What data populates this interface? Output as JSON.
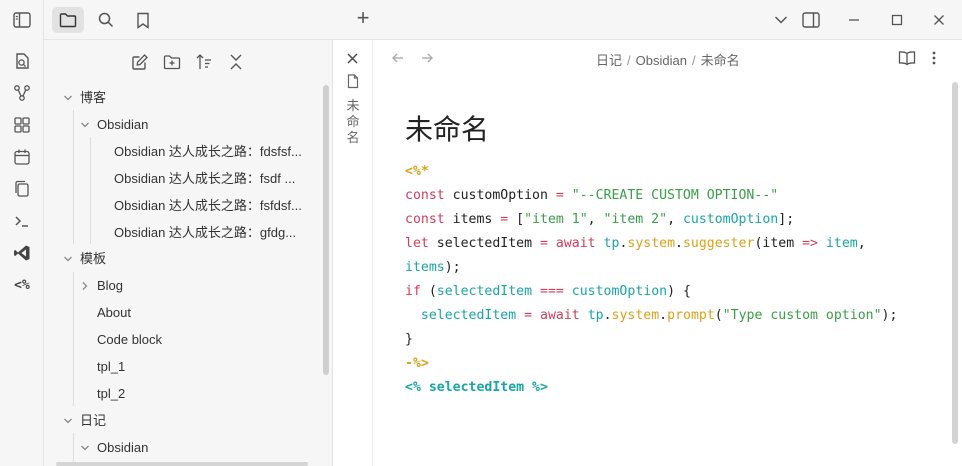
{
  "topbar": {
    "new_tab_symbol": "+"
  },
  "ribbon": {
    "templater_label": "<%"
  },
  "sidebar": {
    "tree": [
      {
        "label": "博客",
        "depth": 0,
        "expanded": true
      },
      {
        "label": "Obsidian",
        "depth": 1,
        "expanded": true
      },
      {
        "label": "Obsidian 达人成长之路：fdsfsf...",
        "depth": 2
      },
      {
        "label": "Obsidian 达人成长之路：fsdf ...",
        "depth": 2
      },
      {
        "label": "Obsidian 达人成长之路：fsfdsf...",
        "depth": 2
      },
      {
        "label": "Obsidian 达人成长之路：gfdg...",
        "depth": 2
      },
      {
        "label": "模板",
        "depth": 0,
        "expanded": true
      },
      {
        "label": "Blog",
        "depth": 1,
        "expanded": false
      },
      {
        "label": "About",
        "depth": 1
      },
      {
        "label": "Code block",
        "depth": 1
      },
      {
        "label": "tpl_1",
        "depth": 1
      },
      {
        "label": "tpl_2",
        "depth": 1
      },
      {
        "label": "日记",
        "depth": 0,
        "expanded": true
      },
      {
        "label": "Obsidian",
        "depth": 1,
        "expanded": true
      }
    ]
  },
  "stacked_tab": {
    "title": "未命名"
  },
  "breadcrumb": {
    "part1": "日记",
    "separator": "/",
    "part2": "Obsidian",
    "part3": "未命名"
  },
  "editor": {
    "title": "未命名",
    "code_lines": [
      [
        {
          "t": "<%*",
          "c": "tag"
        }
      ],
      [
        {
          "t": "const",
          "c": "kw"
        },
        {
          "t": " customOption ",
          "c": "pl"
        },
        {
          "t": "=",
          "c": "kw"
        },
        {
          "t": " ",
          "c": "pl"
        },
        {
          "t": "\"--CREATE CUSTOM OPTION--\"",
          "c": "str"
        }
      ],
      [
        {
          "t": "const",
          "c": "kw"
        },
        {
          "t": " items ",
          "c": "pl"
        },
        {
          "t": "=",
          "c": "kw"
        },
        {
          "t": " [",
          "c": "pl"
        },
        {
          "t": "\"item 1\"",
          "c": "str"
        },
        {
          "t": ", ",
          "c": "pl"
        },
        {
          "t": "\"item 2\"",
          "c": "str"
        },
        {
          "t": ", ",
          "c": "pl"
        },
        {
          "t": "customOption",
          "c": "var"
        },
        {
          "t": "];",
          "c": "pl"
        }
      ],
      [
        {
          "t": "let",
          "c": "kw"
        },
        {
          "t": " selectedItem ",
          "c": "pl"
        },
        {
          "t": "=",
          "c": "kw"
        },
        {
          "t": " ",
          "c": "pl"
        },
        {
          "t": "await",
          "c": "kw"
        },
        {
          "t": " ",
          "c": "pl"
        },
        {
          "t": "tp",
          "c": "var"
        },
        {
          "t": ".",
          "c": "pl"
        },
        {
          "t": "system",
          "c": "fn"
        },
        {
          "t": ".",
          "c": "pl"
        },
        {
          "t": "suggester",
          "c": "fn"
        },
        {
          "t": "(item ",
          "c": "pl"
        },
        {
          "t": "=>",
          "c": "kw"
        },
        {
          "t": " ",
          "c": "pl"
        },
        {
          "t": "item",
          "c": "var"
        },
        {
          "t": ",",
          "c": "pl"
        }
      ],
      [
        {
          "t": "items",
          "c": "var"
        },
        {
          "t": ");",
          "c": "pl"
        }
      ],
      [
        {
          "t": "if",
          "c": "kw"
        },
        {
          "t": " (",
          "c": "pl"
        },
        {
          "t": "selectedItem",
          "c": "var"
        },
        {
          "t": " ",
          "c": "pl"
        },
        {
          "t": "===",
          "c": "kw"
        },
        {
          "t": " ",
          "c": "pl"
        },
        {
          "t": "customOption",
          "c": "var"
        },
        {
          "t": ") {",
          "c": "pl"
        }
      ],
      [
        {
          "t": "  ",
          "c": "pl"
        },
        {
          "t": "selectedItem",
          "c": "var"
        },
        {
          "t": " ",
          "c": "pl"
        },
        {
          "t": "=",
          "c": "kw"
        },
        {
          "t": " ",
          "c": "pl"
        },
        {
          "t": "await",
          "c": "kw"
        },
        {
          "t": " ",
          "c": "pl"
        },
        {
          "t": "tp",
          "c": "var"
        },
        {
          "t": ".",
          "c": "pl"
        },
        {
          "t": "system",
          "c": "fn"
        },
        {
          "t": ".",
          "c": "pl"
        },
        {
          "t": "prompt",
          "c": "fn"
        },
        {
          "t": "(",
          "c": "pl"
        },
        {
          "t": "\"Type custom option\"",
          "c": "str"
        },
        {
          "t": ");",
          "c": "pl"
        }
      ],
      [
        {
          "t": "}",
          "c": "pl"
        }
      ],
      [
        {
          "t": "-%>",
          "c": "tag"
        }
      ],
      [
        {
          "t": "<% selectedItem %>",
          "c": "tag2"
        }
      ]
    ]
  },
  "colors": {
    "keyword": "#d23c5a",
    "string": "#3a9e48",
    "variable": "#1aa5a5",
    "function": "#d9a21b"
  }
}
